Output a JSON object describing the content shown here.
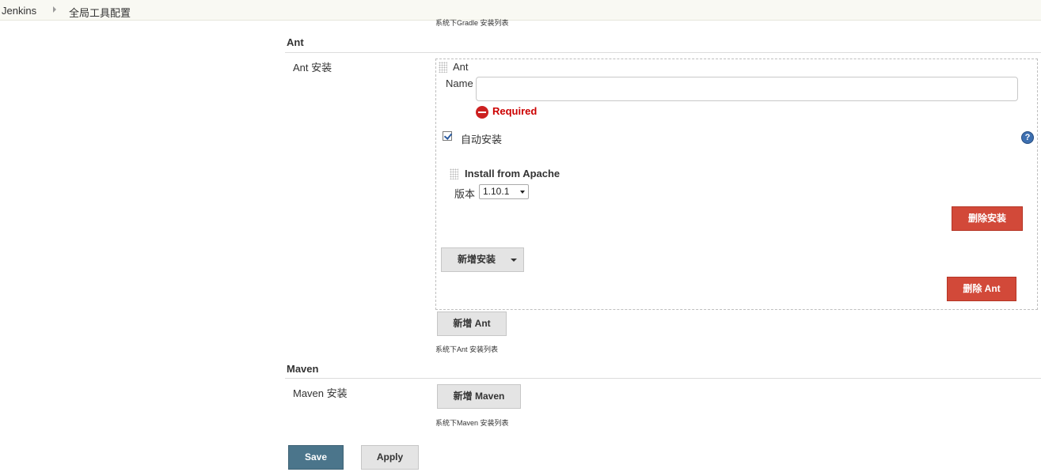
{
  "breadcrumb": {
    "items": [
      "Jenkins",
      "全局工具配置"
    ]
  },
  "gradle": {
    "note": "系统下Gradle 安装列表"
  },
  "ant": {
    "section_title": "Ant",
    "row_label": "Ant 安装",
    "installation": {
      "header": "Ant",
      "name_label": "Name",
      "name_value": "",
      "required_text": "Required",
      "auto_install_label": "自动安装",
      "auto_install_checked": true,
      "help_icon": "?",
      "installer": {
        "title": "Install from Apache",
        "version_label": "版本",
        "version_selected": "1.10.1",
        "delete_installer_label": "删除安装"
      },
      "add_installer_label": "新增安装",
      "delete_ant_label": "删除 Ant"
    },
    "add_ant_label": "新增 Ant",
    "note": "系统下Ant 安装列表"
  },
  "maven": {
    "section_title": "Maven",
    "row_label": "Maven 安装",
    "add_maven_label": "新增 Maven",
    "note": "系统下Maven 安装列表"
  },
  "footer": {
    "save_label": "Save",
    "apply_label": "Apply"
  },
  "colors": {
    "danger": "#d24939",
    "primary": "#4b758b",
    "error": "#cc0000",
    "help": "#3d6fb0"
  }
}
